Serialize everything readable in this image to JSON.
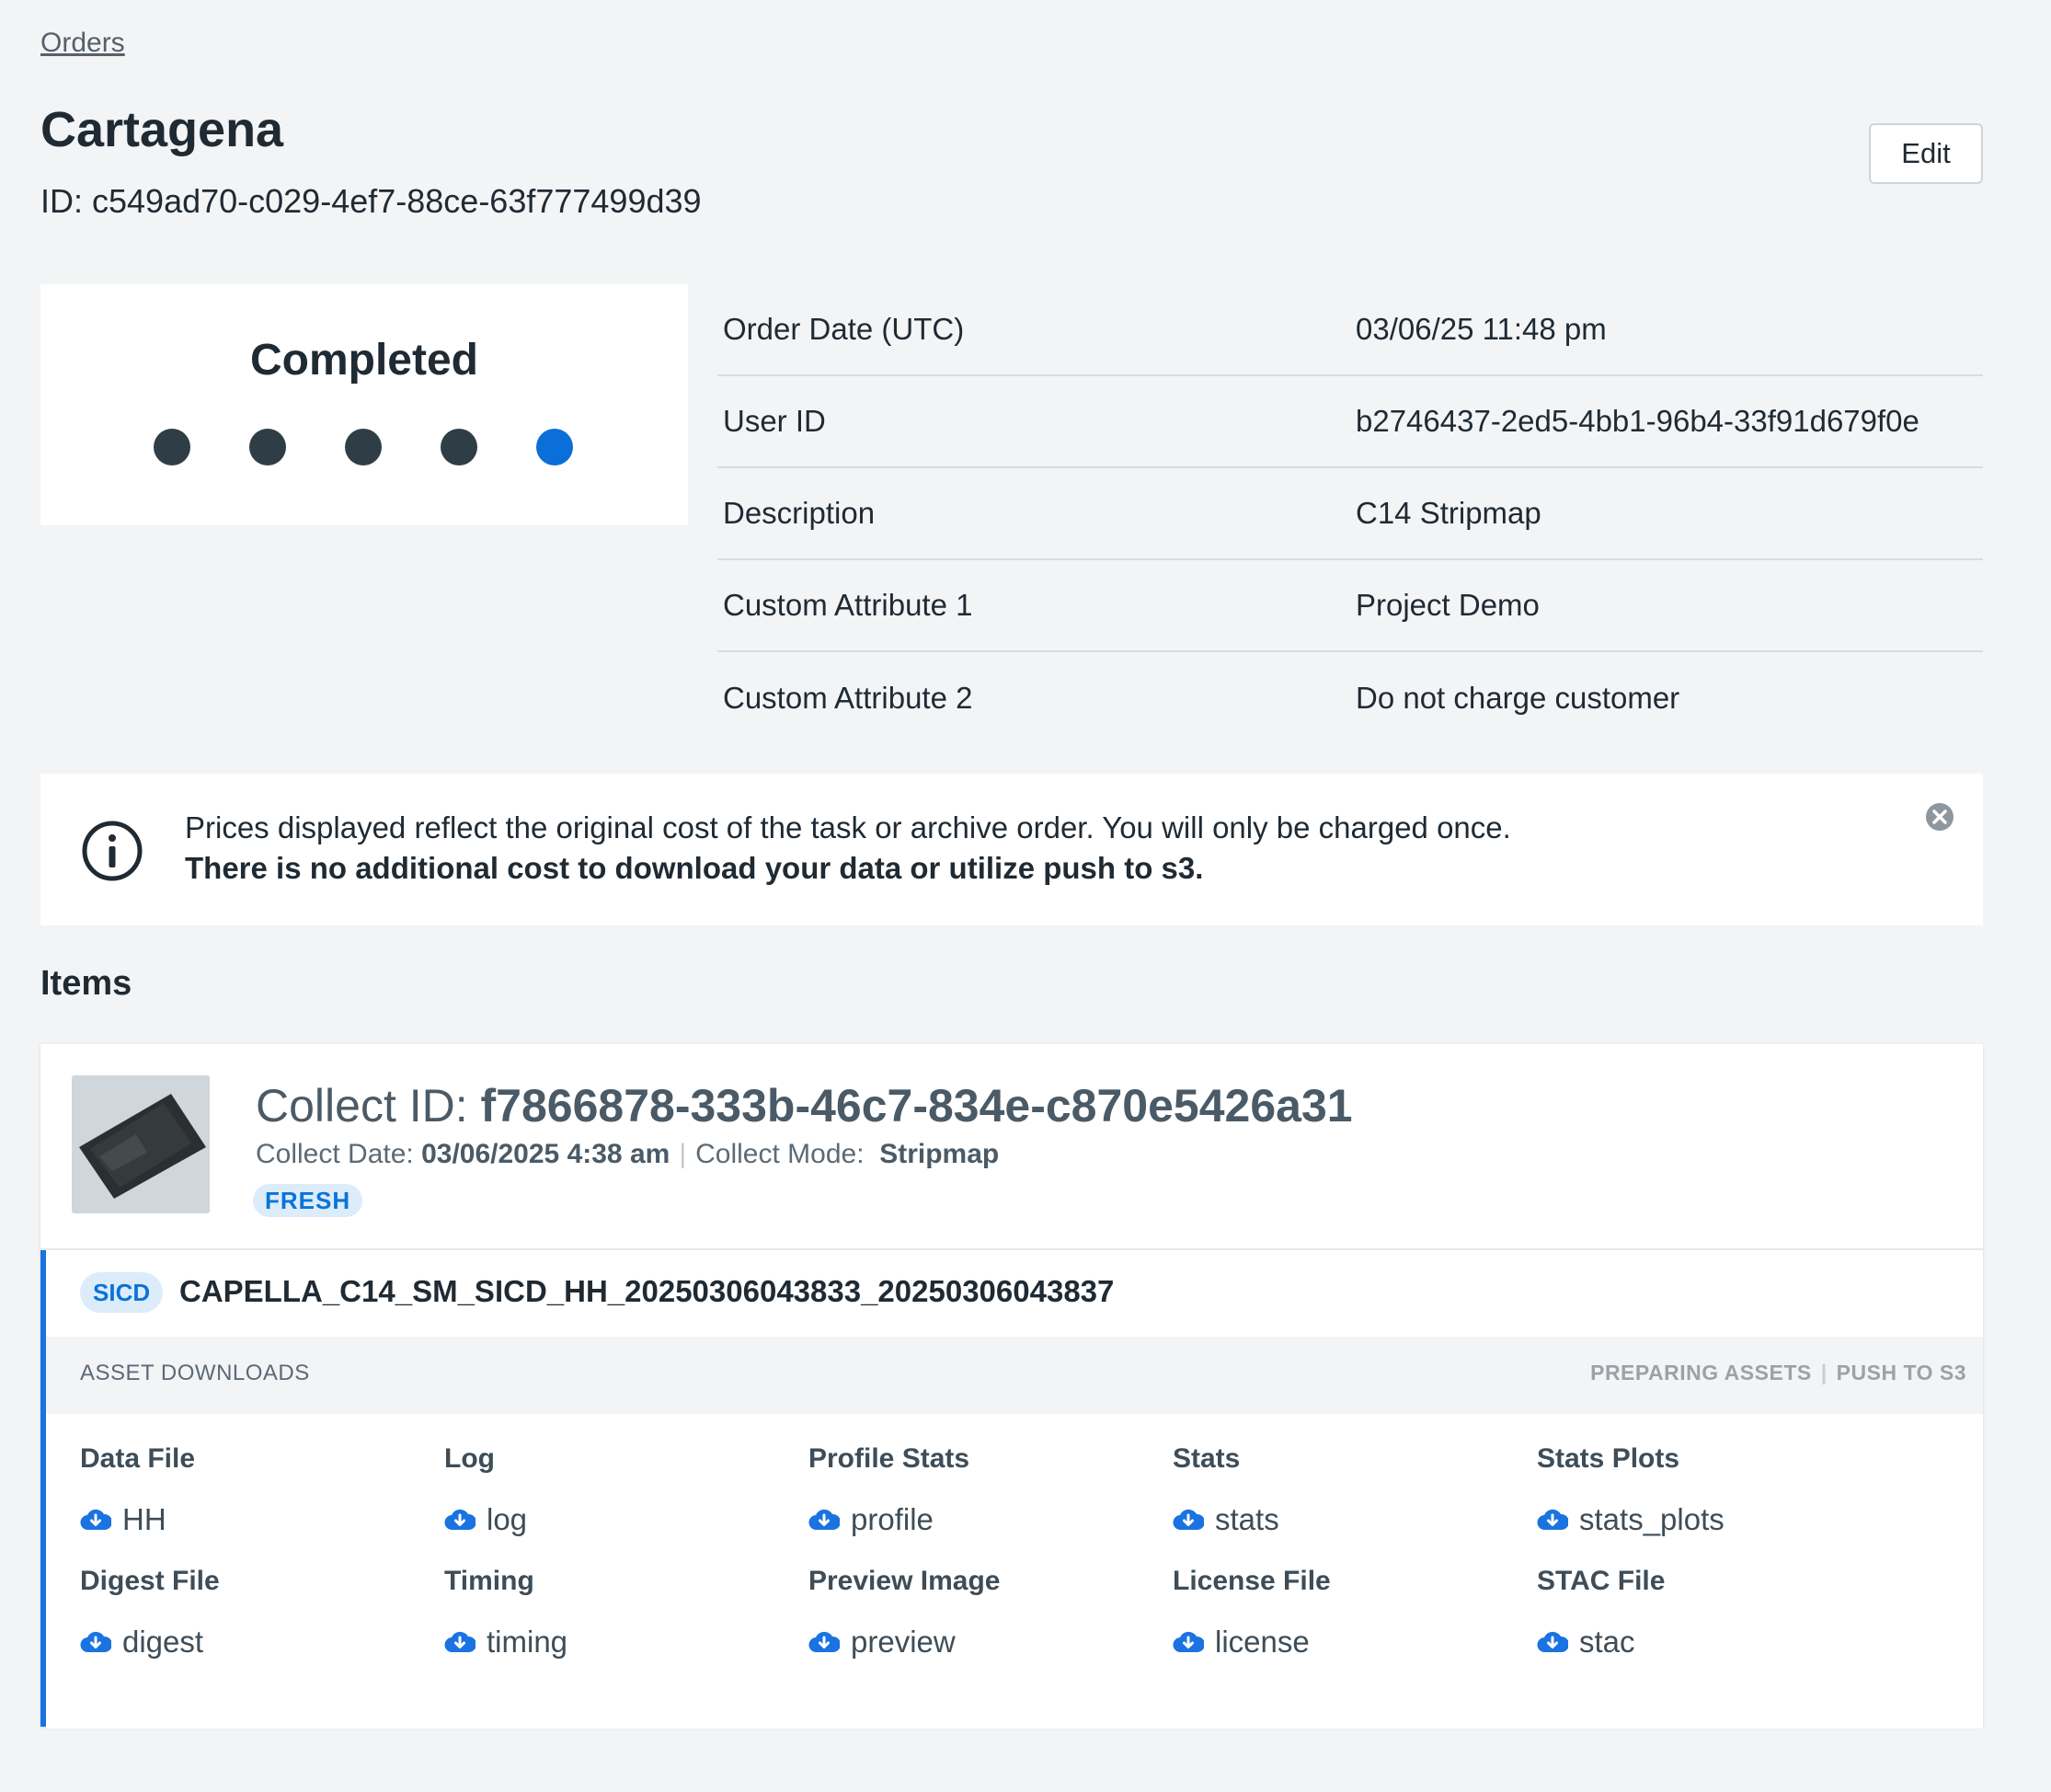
{
  "breadcrumb": "Orders",
  "order": {
    "title": "Cartagena",
    "id_text": "ID: c549ad70-c029-4ef7-88ce-63f777499d39",
    "edit_label": "Edit"
  },
  "status": {
    "label": "Completed",
    "steps_total": 5,
    "current_step": 5,
    "done_color": "#2f3d46",
    "active_color": "#0a6fd8"
  },
  "details": [
    {
      "label": "Order Date (UTC)",
      "value": "03/06/25 11:48 pm"
    },
    {
      "label": "User ID",
      "value": "b2746437-2ed5-4bb1-96b4-33f91d679f0e"
    },
    {
      "label": "Description",
      "value": "C14 Stripmap"
    },
    {
      "label": "Custom Attribute 1",
      "value": "Project Demo"
    },
    {
      "label": "Custom Attribute 2",
      "value": "Do not charge customer"
    }
  ],
  "notice": {
    "line1": "Prices displayed reflect the original cost of the task or archive order. You will only be charged once.",
    "line2": "There is no additional cost to download your data or utilize push to s3."
  },
  "items_heading": "Items",
  "item": {
    "collect_id_label": "Collect ID:",
    "collect_id": "f7866878-333b-46c7-834e-c870e5426a31",
    "collect_date_label": "Collect Date:",
    "collect_date": "03/06/2025 4:38 am",
    "collect_mode_label": "Collect Mode:",
    "collect_mode": "Stripmap",
    "badge": "FRESH",
    "product": {
      "type_badge": "SICD",
      "name": "CAPELLA_C14_SM_SICD_HH_20250306043833_20250306043837",
      "downloads_title": "ASSET DOWNLOADS",
      "action_preparing": "PREPARING ASSETS",
      "action_push": "PUSH TO S3",
      "assets": [
        {
          "label": "Data File",
          "link": "HH"
        },
        {
          "label": "Log",
          "link": "log"
        },
        {
          "label": "Profile Stats",
          "link": "profile"
        },
        {
          "label": "Stats",
          "link": "stats"
        },
        {
          "label": "Stats Plots",
          "link": "stats_plots"
        },
        {
          "label": "Digest File",
          "link": "digest"
        },
        {
          "label": "Timing",
          "link": "timing"
        },
        {
          "label": "Preview Image",
          "link": "preview"
        },
        {
          "label": "License File",
          "link": "license"
        },
        {
          "label": "STAC File",
          "link": "stac"
        }
      ],
      "download_icon_color": "#1a73e0"
    }
  }
}
